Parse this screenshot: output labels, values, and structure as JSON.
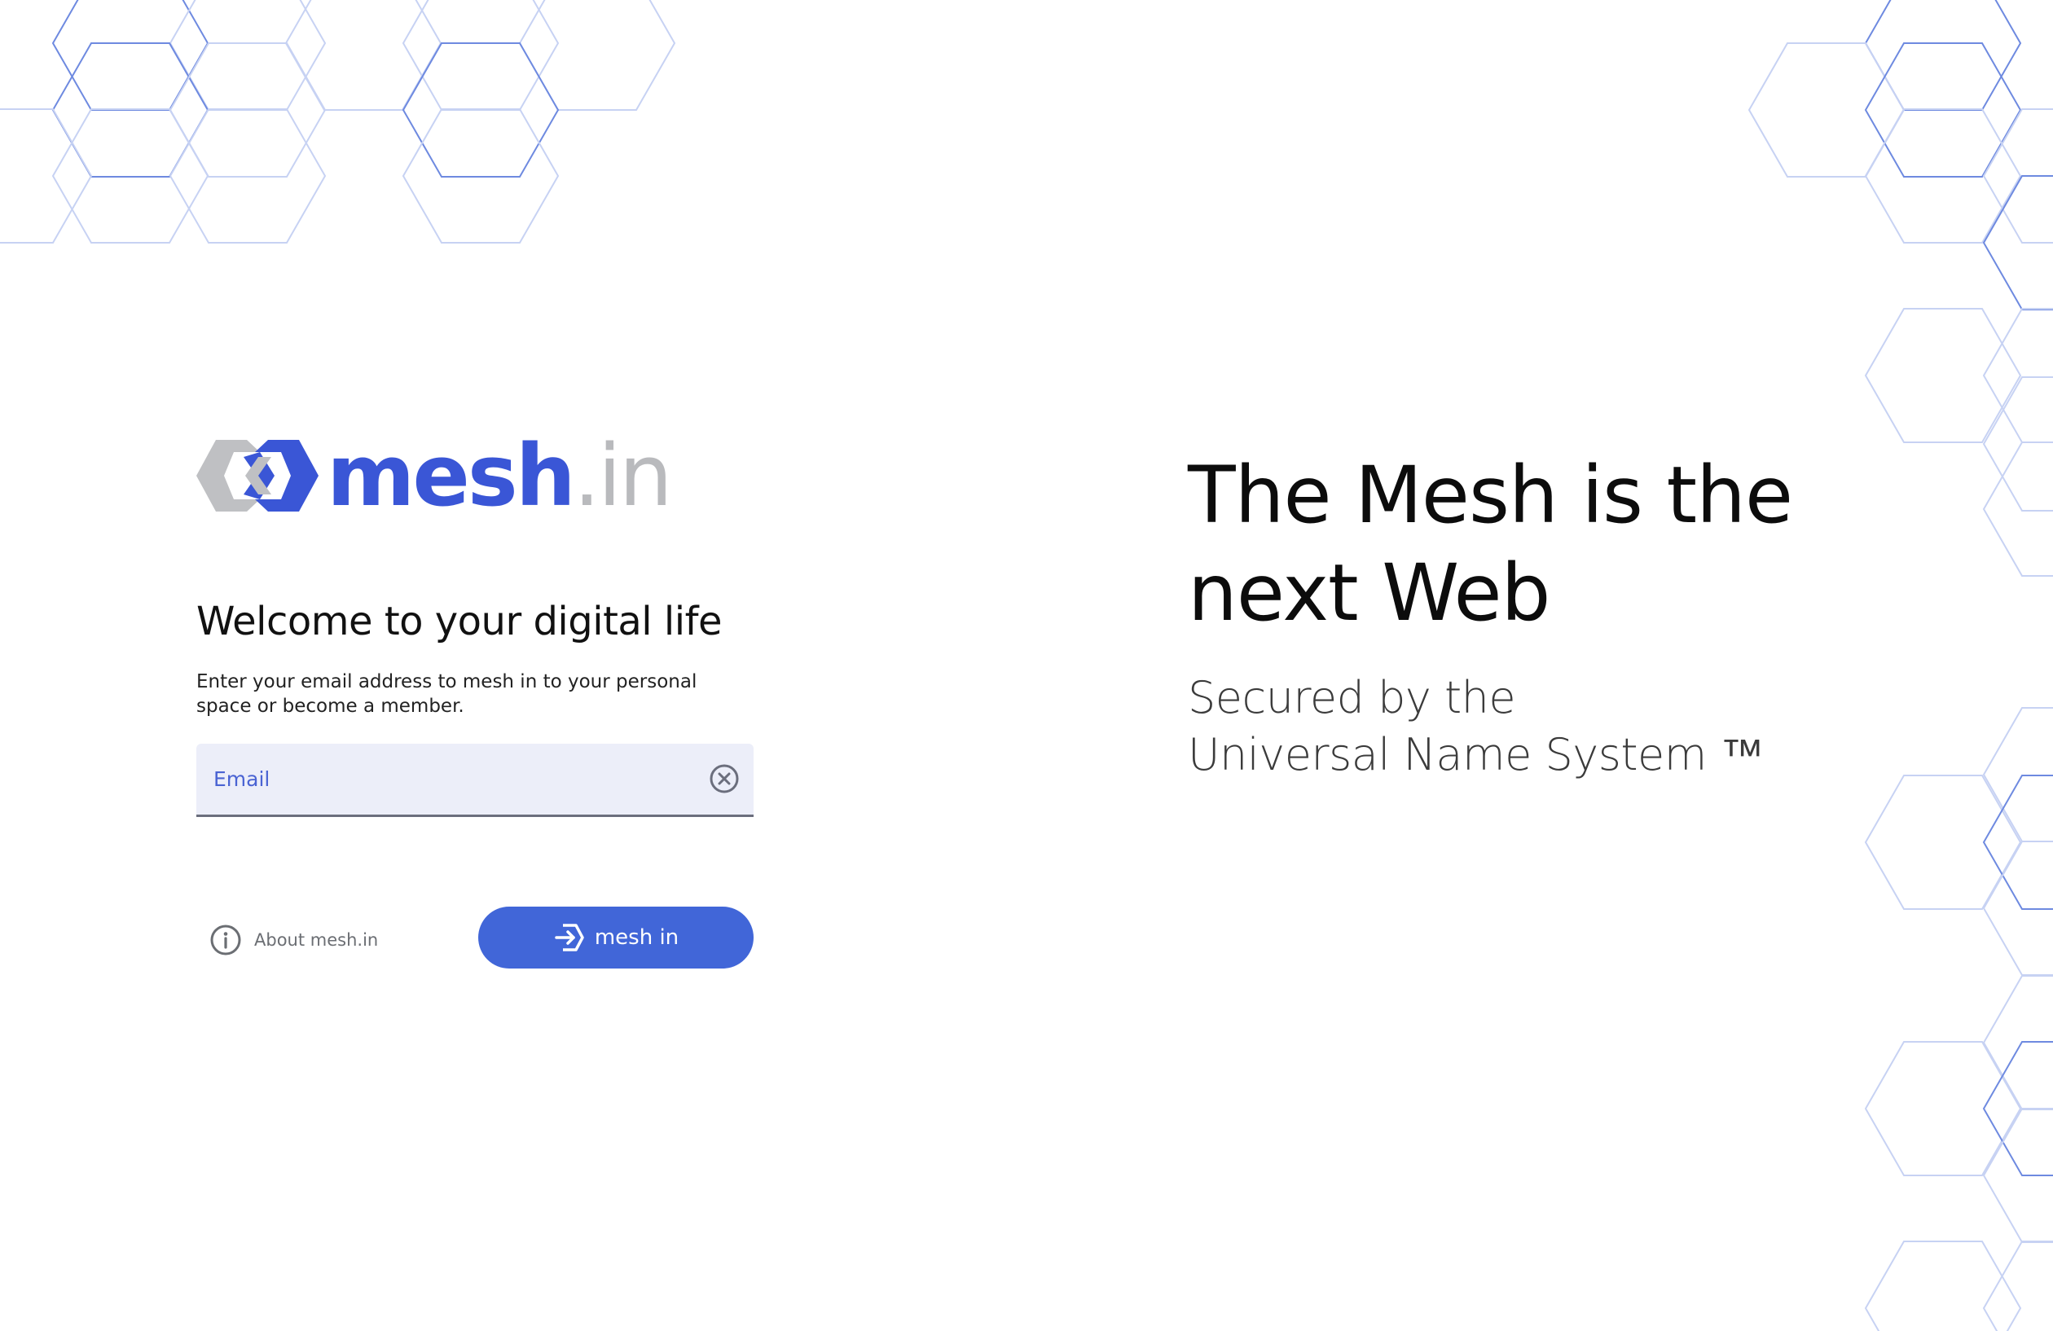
{
  "colors": {
    "brand_blue": "#3a56d6",
    "button_blue": "#4166d8",
    "logo_gray": "#b9babd",
    "field_background": "#eceef9",
    "hex_stroke_dark": "#6e8ae0",
    "hex_stroke_light": "#c7d2f3"
  },
  "logo": {
    "word": "mesh",
    "tld": ".in",
    "icon": "mesh-chain-logo-icon"
  },
  "login": {
    "welcome_title": "Welcome to your digital life",
    "instructions": "Enter your email address to mesh in to your personal space or become a member.",
    "email": {
      "placeholder": "Email",
      "value": "",
      "clear_icon": "clear-circle-x-icon"
    },
    "about": {
      "icon": "info-circle-icon",
      "label": "About mesh.in"
    },
    "submit": {
      "icon": "login-arrow-hex-icon",
      "label": "mesh in"
    }
  },
  "hero": {
    "title_line1": "The Mesh is the",
    "title_line2": "next Web",
    "subtitle_line1": "Secured by the",
    "subtitle_line2": "Universal Name System ™"
  }
}
